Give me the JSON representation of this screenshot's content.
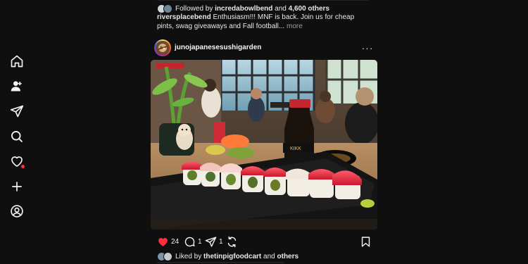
{
  "nav": {
    "items": [
      {
        "name": "home",
        "icon": "home-icon"
      },
      {
        "name": "people",
        "icon": "people-icon"
      },
      {
        "name": "messages",
        "icon": "paper-plane-icon"
      },
      {
        "name": "search",
        "icon": "search-icon"
      },
      {
        "name": "notifications",
        "icon": "heart-icon",
        "has_dot": true
      },
      {
        "name": "create",
        "icon": "plus-icon"
      },
      {
        "name": "profile",
        "icon": "profile-icon"
      }
    ]
  },
  "prev_post": {
    "followed_by_prefix": "Followed by",
    "followed_by_user": "incredabowlbend",
    "followed_by_and": "and",
    "followed_by_count": "4,600 others",
    "caption_user": "riversplacebend",
    "caption_text": "Enthusiasm!!! MNF is back. Join us for cheap pints, swag giveaways and Fall football...",
    "more": "more"
  },
  "post": {
    "username": "junojapanesesushigarden",
    "likes": "24",
    "comments": "1",
    "shares": "1",
    "liked_prefix": "Liked by",
    "liked_user": "thetinpigfoodcart",
    "liked_and": "and",
    "liked_others": "others"
  },
  "colors": {
    "background": "#0f0f10",
    "like_red": "#ff3040",
    "text": "#f3f3f3"
  }
}
